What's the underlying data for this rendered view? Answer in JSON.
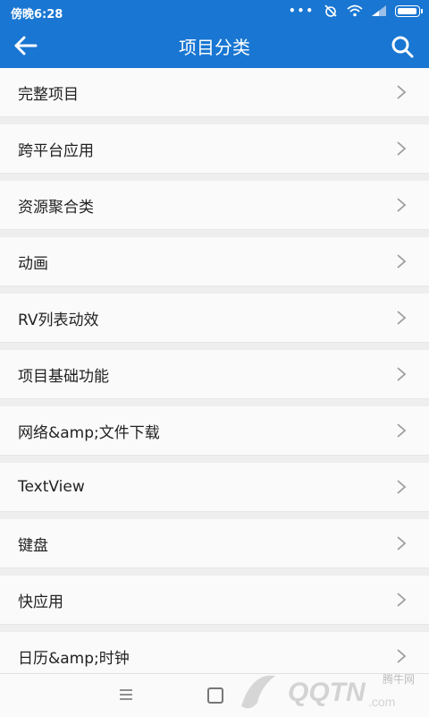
{
  "status_bar": {
    "time": "傍晚6:28",
    "dots": "•••"
  },
  "toolbar": {
    "title": "项目分类",
    "back_icon": "arrow-left-icon",
    "search_icon": "search-icon"
  },
  "categories": [
    {
      "label": "完整项目"
    },
    {
      "label": "跨平台应用"
    },
    {
      "label": "资源聚合类"
    },
    {
      "label": "动画"
    },
    {
      "label": "RV列表动效"
    },
    {
      "label": "项目基础功能"
    },
    {
      "label": "网络&amp;文件下载"
    },
    {
      "label": "TextView"
    },
    {
      "label": "键盘"
    },
    {
      "label": "快应用"
    },
    {
      "label": "日历&amp;时钟"
    }
  ],
  "watermark": {
    "brand": "QQTN",
    "suffix": ".com",
    "caption": "腾牛网"
  },
  "colors": {
    "primary": "#1976d2",
    "row_bg": "#fafafa",
    "separator": "#eeeeee"
  }
}
